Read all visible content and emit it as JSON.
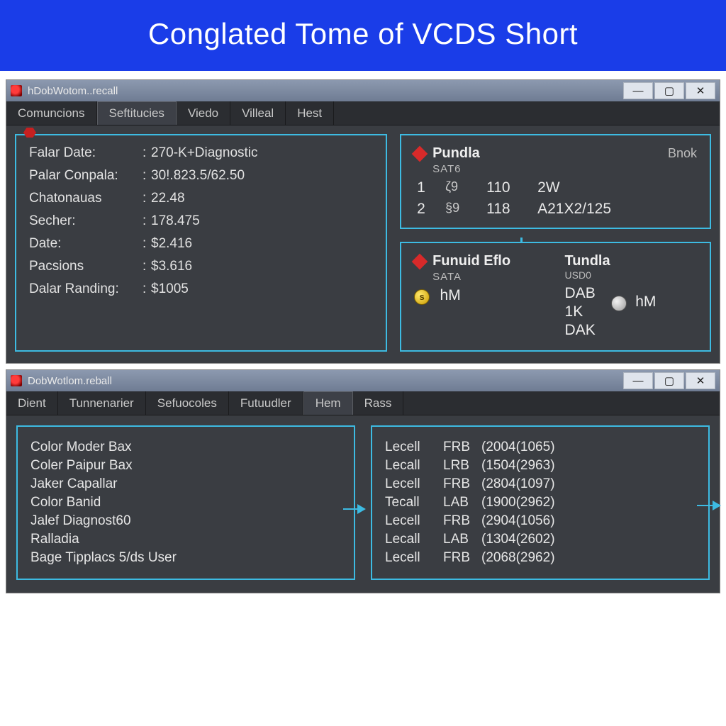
{
  "banner": "Conglated Tome of VCDS Short",
  "win1": {
    "title": "hDobWotom..recall",
    "menu": [
      "Comuncions",
      "Seftitucies",
      "Viedo",
      "Villeal",
      "Hest"
    ],
    "menu_active_index": 1,
    "kv": [
      {
        "label": "Falar Date:",
        "value": "270-K+Diagnostic"
      },
      {
        "label": "Palar Conpala:",
        "value": "30!.823.5/62.50"
      },
      {
        "label": "Chatonauas",
        "value": "22.48"
      },
      {
        "label": "Secher:",
        "value": "178.475"
      },
      {
        "label": "Date:",
        "value": "$2.416"
      },
      {
        "label": "Pacsions",
        "value": "$3.616"
      },
      {
        "label": "Dalar Randing:",
        "value": "$1005"
      }
    ],
    "topRight": {
      "title": "Pundla",
      "sub": "Bnok",
      "subt": "SAT6",
      "rows": [
        {
          "n": "1",
          "ico": "ζ9",
          "a": "110",
          "b": "2W"
        },
        {
          "n": "2",
          "ico": "§9",
          "a": "118",
          "b": "A21X2/125"
        }
      ]
    },
    "botRight": {
      "left": {
        "title": "Funuid Eflo",
        "sub": "SATA",
        "medal": "s",
        "lab": "hM"
      },
      "right": {
        "title": "Tundla",
        "sub": "USD0",
        "big1": "DAB",
        "big2": "1K",
        "big3": "DAK",
        "lab": "hM"
      }
    }
  },
  "win2": {
    "title": "DobWotlom.reball",
    "menu": [
      "Dient",
      "Tunnenarier",
      "Sefuocoles",
      "Futuudler",
      "Hem",
      "Rass"
    ],
    "menu_active_index": 4,
    "left": [
      "Color Moder Bax",
      "Coler Paipur Bax",
      "Jaker Capallar",
      "Color Banid",
      "Jalef Diagnost60",
      "Ralladia",
      "Bage Tipplacs 5/ds User"
    ],
    "right": [
      {
        "a": "Lecell",
        "b": "FRB",
        "c": "(2004(1065)"
      },
      {
        "a": "Lecall",
        "b": "LRB",
        "c": "(1504(2963)"
      },
      {
        "a": "Lecell",
        "b": "FRB",
        "c": "(2804(1097)"
      },
      {
        "a": "Tecall",
        "b": "LAB",
        "c": "(1900(2962)"
      },
      {
        "a": "Lecell",
        "b": "FRB",
        "c": "(2904(1056)"
      },
      {
        "a": "Lecall",
        "b": "LAB",
        "c": "(1304(2602)"
      },
      {
        "a": "Lecell",
        "b": "FRB",
        "c": "(2068(2962)"
      }
    ]
  }
}
